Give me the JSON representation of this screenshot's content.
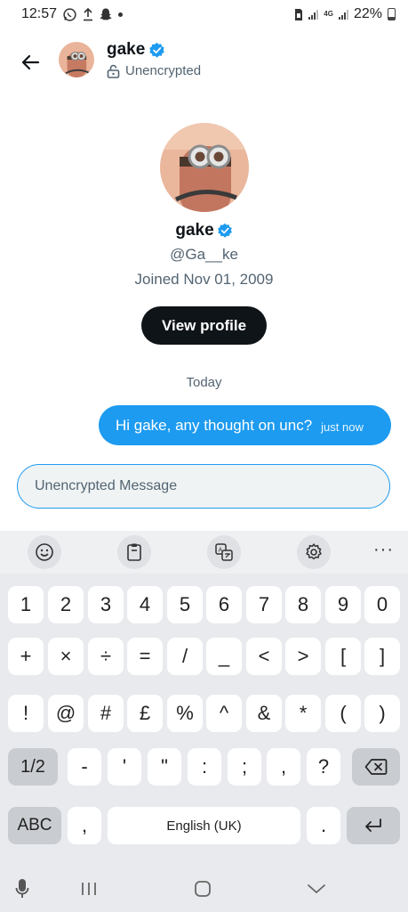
{
  "status_bar": {
    "time": "12:57",
    "battery": "22%",
    "network": "4G",
    "left_icons": [
      "whatsapp-icon",
      "upload-icon",
      "snapchat-icon",
      "dot-icon"
    ],
    "right_icons": [
      "sim-icon",
      "signal-icon",
      "4g-icon",
      "signal-icon",
      "battery-icon"
    ]
  },
  "header": {
    "name": "gake",
    "status": "Unencrypted",
    "verified": true
  },
  "profile": {
    "name": "gake",
    "handle": "@Ga__ke",
    "joined": "Joined Nov 01, 2009",
    "view_profile_label": "View profile"
  },
  "conversation": {
    "day_label": "Today",
    "messages": [
      {
        "text": "Hi gake, any thought on unc?",
        "time": "just now",
        "from": "me"
      }
    ]
  },
  "composer": {
    "placeholder": "Unencrypted Message",
    "value": ""
  },
  "keyboard": {
    "toolbar": [
      "emoji-icon",
      "clipboard-icon",
      "translate-icon",
      "settings-icon",
      "more-icon"
    ],
    "more_label": "···",
    "rows": [
      [
        "1",
        "2",
        "3",
        "4",
        "5",
        "6",
        "7",
        "8",
        "9",
        "0"
      ],
      [
        "+",
        "×",
        "÷",
        "=",
        "/",
        "_",
        "<",
        ">",
        "[",
        "]"
      ],
      [
        "!",
        "@",
        "#",
        "£",
        "%",
        "^",
        "&",
        "*",
        "(",
        ")"
      ]
    ],
    "row4": {
      "shift": "1/2",
      "keys": [
        "-",
        "'",
        "\"",
        ":",
        ";",
        ",",
        "?"
      ]
    },
    "row5": {
      "abc": "ABC",
      "comma": ",",
      "space": "English (UK)",
      "period": "."
    }
  },
  "colors": {
    "accent": "#1d9bf0",
    "text_primary": "#0f1419",
    "text_secondary": "#536471",
    "keyboard_bg": "#e8eaed"
  }
}
